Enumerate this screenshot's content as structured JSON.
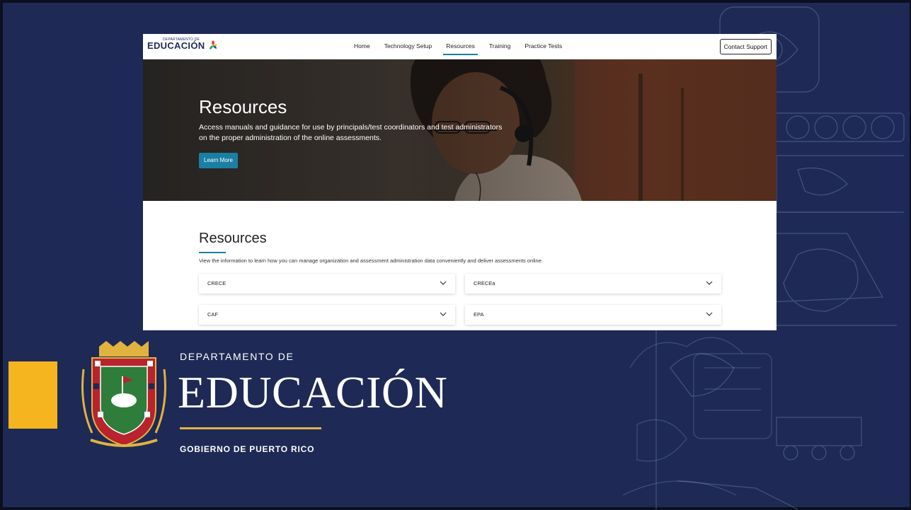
{
  "slide": {
    "department_small": "DEPARTAMENTO DE",
    "department_big": "EDUCACIÓN",
    "government": "GOBIERNO DE PUERTO RICO"
  },
  "site": {
    "brand": {
      "small": "DEPARTAMENTO DE",
      "big": "EDUCACIÓN"
    },
    "nav": {
      "items": [
        {
          "label": "Home",
          "active": false
        },
        {
          "label": "Technology Setup",
          "active": false
        },
        {
          "label": "Resources",
          "active": true
        },
        {
          "label": "Training",
          "active": false
        },
        {
          "label": "Practice Tests",
          "active": false
        }
      ],
      "contact_label": "Contact Support"
    },
    "hero": {
      "title": "Resources",
      "text": "Access manuals and guidance for use by principals/test coordinators and test administrators on the proper administration of the online assessments.",
      "button_label": "Learn More"
    },
    "resources": {
      "title": "Resources",
      "description": "View the information to learn how you can manage organization and assessment administration data conveniently and deliver assessments online.",
      "accordions": [
        {
          "label": "CRECE"
        },
        {
          "label": "CRECEa"
        },
        {
          "label": "CAF"
        },
        {
          "label": "EPA"
        }
      ]
    }
  },
  "colors": {
    "slide_background": "#1e2a55",
    "accent_gold": "#f4b51f",
    "site_accent": "#1b7fa3"
  }
}
